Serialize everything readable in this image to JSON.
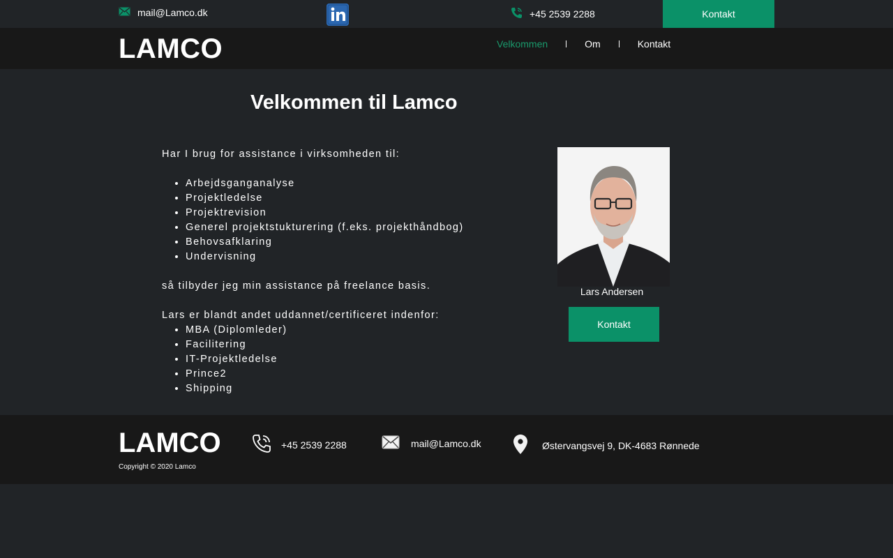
{
  "topbar": {
    "email": "mail@Lamco.dk",
    "phone": "+45 2539 2288",
    "contact_button": "Kontakt",
    "linkedin_label": "in"
  },
  "header": {
    "logo": "LAMCO",
    "nav": [
      {
        "label": "Velkommen",
        "active": true
      },
      {
        "label": "Om",
        "active": false
      },
      {
        "label": "Kontakt",
        "active": false
      }
    ]
  },
  "main": {
    "title": "Velkommen til Lamco",
    "intro": "Har I brug for assistance i virksomheden til:",
    "services": [
      "Arbejdsganganalyse",
      "Projektledelse",
      "Projektrevision",
      "Generel projektstukturering (f.eks. projekthåndbog)",
      "Behovsafklaring",
      "Undervisning"
    ],
    "offer": "så tilbyder jeg min assistance på freelance basis.",
    "cert_intro": "Lars er blandt andet uddannet/certificeret indenfor:",
    "certifications": [
      "MBA (Diplomleder)",
      "Facilitering",
      "IT-Projektledelse",
      "Prince2",
      "Shipping"
    ],
    "person_name": "Lars Andersen",
    "contact_button": "Kontakt"
  },
  "footer": {
    "logo": "LAMCO",
    "copyright": "Copyright © 2020 Lamco",
    "phone": "+45 2539 2288",
    "email": "mail@Lamco.dk",
    "address": "Østervangsvej 9, DK-4683 Rønnede"
  },
  "colors": {
    "accent": "#0b9168",
    "active_nav": "#1a9a6c",
    "background": "#212427",
    "header_bg": "#181818",
    "linkedin": "#2b67b0"
  }
}
